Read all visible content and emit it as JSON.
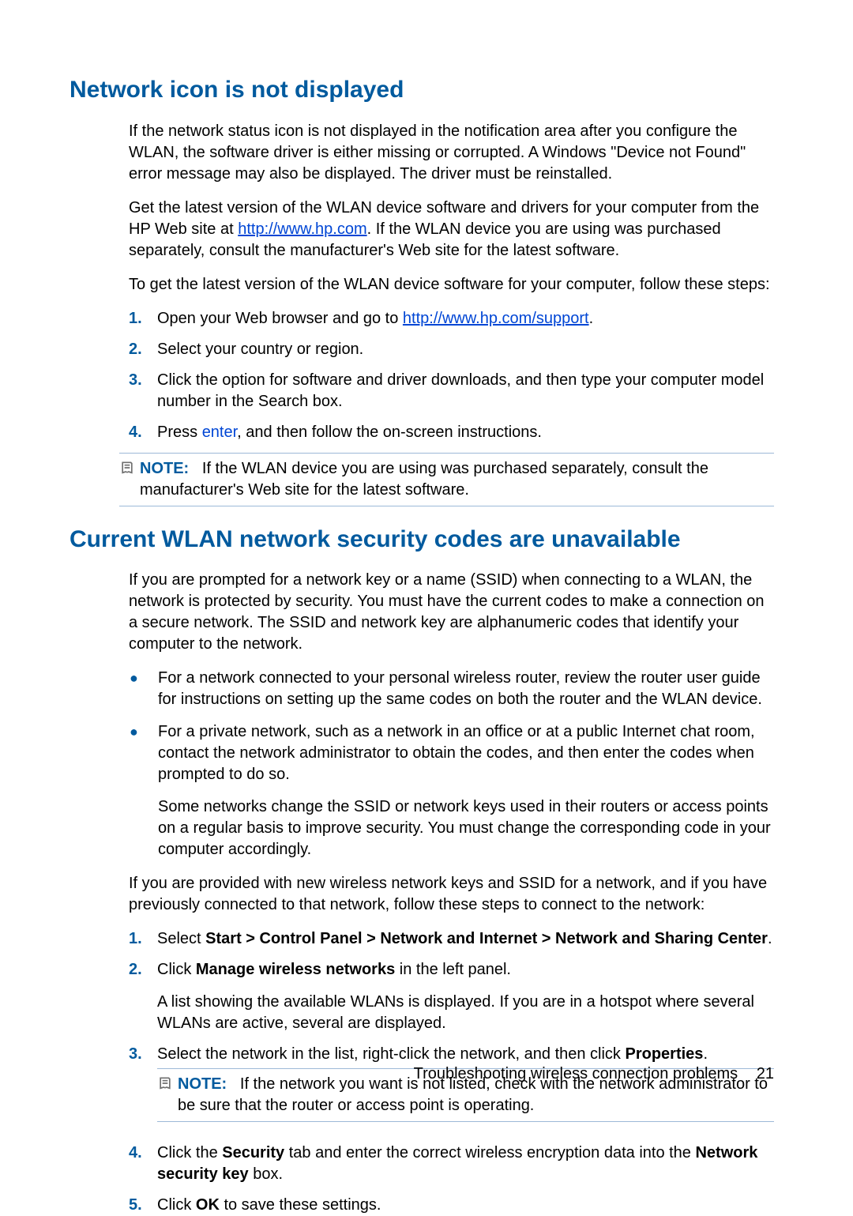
{
  "section1": {
    "title": "Network icon is not displayed",
    "para1": "If the network status icon is not displayed in the notification area after you configure the WLAN, the software driver is either missing or corrupted. A Windows \"Device not Found\" error message may also be displayed. The driver must be reinstalled.",
    "para2a": "Get the latest version of the WLAN device software and drivers for your computer from the HP Web site at ",
    "para2link": "http://www.hp.com",
    "para2b": ". If the WLAN device you are using was purchased separately, consult the manufacturer's Web site for the latest software.",
    "para3": "To get the latest version of the WLAN device software for your computer, follow these steps:",
    "steps": [
      {
        "num": "1.",
        "pre": "Open your Web browser and go to ",
        "link": "http://www.hp.com/support",
        "post": "."
      },
      {
        "num": "2.",
        "pre": "Select your country or region."
      },
      {
        "num": "3.",
        "pre": "Click the option for software and driver downloads, and then type your computer model number in the Search box."
      },
      {
        "num": "4.",
        "pre": "Press ",
        "blue": "enter",
        "post": ", and then follow the on-screen instructions."
      }
    ],
    "note": {
      "label": "NOTE:",
      "text": "If the WLAN device you are using was purchased separately, consult the manufacturer's Web site for the latest software."
    }
  },
  "section2": {
    "title": "Current WLAN network security codes are unavailable",
    "para1": "If you are prompted for a network key or a name (SSID) when connecting to a WLAN, the network is protected by security. You must have the current codes to make a connection on a secure network. The SSID and network key are alphanumeric codes that identify your computer to the network.",
    "bullets": [
      {
        "text": "For a network connected to your personal wireless router, review the router user guide for instructions on setting up the same codes on both the router and the WLAN device."
      },
      {
        "text": "For a private network, such as a network in an office or at a public Internet chat room, contact the network administrator to obtain the codes, and then enter the codes when prompted to do so.",
        "extra": "Some networks change the SSID or network keys used in their routers or access points on a regular basis to improve security. You must change the corresponding code in your computer accordingly."
      }
    ],
    "para2": "If you are provided with new wireless network keys and SSID for a network, and if you have previously connected to that network, follow these steps to connect to the network:",
    "steps": [
      {
        "num": "1.",
        "parts": [
          {
            "t": "Select "
          },
          {
            "b": "Start > Control Panel > Network and Internet > Network and Sharing Center"
          },
          {
            "t": "."
          }
        ]
      },
      {
        "num": "2.",
        "parts": [
          {
            "t": "Click "
          },
          {
            "b": "Manage wireless networks"
          },
          {
            "t": " in the left panel."
          }
        ],
        "extra": "A list showing the available WLANs is displayed. If you are in a hotspot where several WLANs are active, several are displayed."
      },
      {
        "num": "3.",
        "parts": [
          {
            "t": "Select the network in the list, right-click the network, and then click "
          },
          {
            "b": "Properties"
          },
          {
            "t": "."
          }
        ],
        "note": {
          "label": "NOTE:",
          "text": "If the network you want is not listed, check with the network administrator to be sure that the router or access point is operating."
        }
      },
      {
        "num": "4.",
        "parts": [
          {
            "t": "Click the "
          },
          {
            "b": "Security"
          },
          {
            "t": " tab and enter the correct wireless encryption data into the "
          },
          {
            "b": "Network security key"
          },
          {
            "t": " box."
          }
        ]
      },
      {
        "num": "5.",
        "parts": [
          {
            "t": "Click "
          },
          {
            "b": "OK"
          },
          {
            "t": " to save these settings."
          }
        ]
      }
    ]
  },
  "footer": {
    "label": "Troubleshooting wireless connection problems",
    "page": "21"
  }
}
